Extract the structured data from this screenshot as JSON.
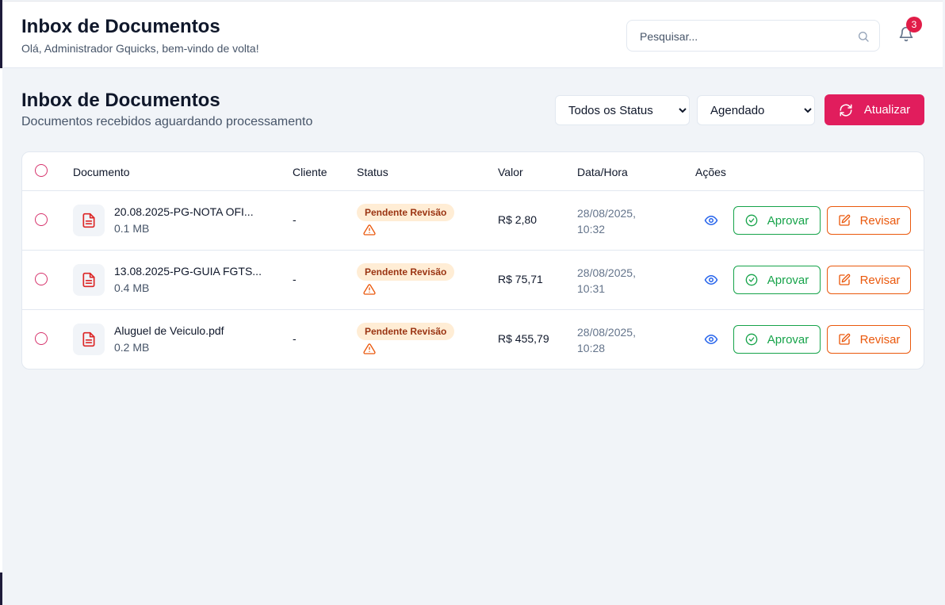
{
  "header": {
    "title": "Inbox de Documentos",
    "subtitle": "Olá, Administrador Gquicks, bem-vindo de volta!",
    "search_placeholder": "Pesquisar...",
    "notification_count": "3"
  },
  "page": {
    "title": "Inbox de Documentos",
    "subtitle": "Documentos recebidos aguardando processamento",
    "status_filter": {
      "selected": "Todos os Status",
      "options": [
        "Todos os Status"
      ]
    },
    "type_filter": {
      "selected": "Agendado",
      "options": [
        "Agendado"
      ]
    },
    "refresh_label": "Atualizar"
  },
  "table": {
    "columns": {
      "document": "Documento",
      "client": "Cliente",
      "status": "Status",
      "value": "Valor",
      "datetime": "Data/Hora",
      "actions": "Ações"
    },
    "rows": [
      {
        "name": "20.08.2025-PG-NOTA OFI...",
        "size": "0.1 MB",
        "client": "-",
        "status": "Pendente Revisão",
        "value": "R$ 2,80",
        "date": "28/08/2025,",
        "time": "10:32",
        "approve": "Aprovar",
        "review": "Revisar"
      },
      {
        "name": "13.08.2025-PG-GUIA FGTS...",
        "size": "0.4 MB",
        "client": "-",
        "status": "Pendente Revisão",
        "value": "R$ 75,71",
        "date": "28/08/2025,",
        "time": "10:31",
        "approve": "Aprovar",
        "review": "Revisar"
      },
      {
        "name": "Aluguel de Veiculo.pdf",
        "size": "0.2 MB",
        "client": "-",
        "status": "Pendente Revisão",
        "value": "R$ 455,79",
        "date": "28/08/2025,",
        "time": "10:28",
        "approve": "Aprovar",
        "review": "Revisar"
      }
    ]
  },
  "colors": {
    "accent": "#e11d5d",
    "approve": "#16a34a",
    "review": "#ea580c",
    "pending_badge_bg": "#ffedd5",
    "pending_badge_text": "#9a3412"
  },
  "icons": [
    "search-icon",
    "bell-icon",
    "refresh-icon",
    "file-icon",
    "warning-icon",
    "eye-icon",
    "check-circle-icon",
    "edit-icon"
  ]
}
